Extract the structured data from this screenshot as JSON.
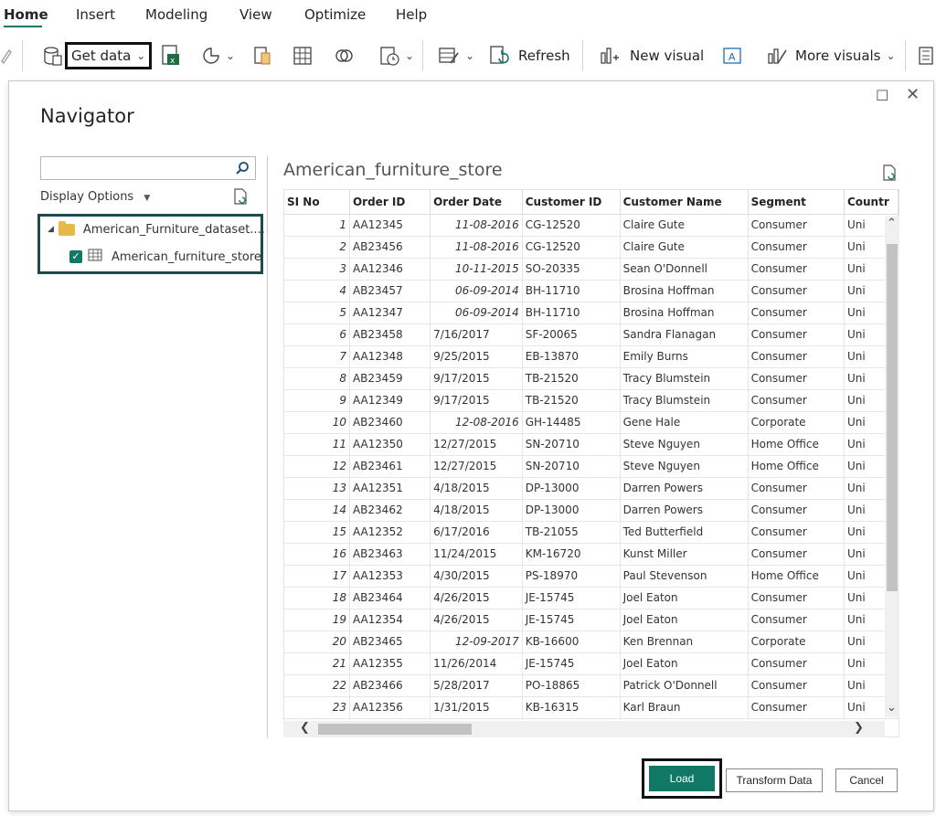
{
  "ribbon": {
    "tabs": [
      "Home",
      "Insert",
      "Modeling",
      "View",
      "Optimize",
      "Help"
    ],
    "get_data_label": "Get data",
    "refresh_label": "Refresh",
    "new_visual_label": "New visual",
    "more_visuals_label": "More visuals"
  },
  "navigator": {
    "title": "Navigator",
    "search": {
      "value": "",
      "placeholder": ""
    },
    "display_options_label": "Display Options",
    "tree": {
      "folder_label": "American_Furniture_dataset....",
      "item_label": "American_furniture_store",
      "item_checked": true
    },
    "preview_title": "American_furniture_store",
    "columns": [
      "SI No",
      "Order ID",
      "Order Date",
      "Customer ID",
      "Customer Name",
      "Segment",
      "Countr"
    ],
    "rows": [
      [
        "1",
        "AA12345",
        "11-08-2016",
        "CG-12520",
        "Claire Gute",
        "Consumer",
        "Uni"
      ],
      [
        "2",
        "AB23456",
        "11-08-2016",
        "CG-12520",
        "Claire Gute",
        "Consumer",
        "Uni"
      ],
      [
        "3",
        "AA12346",
        "10-11-2015",
        "SO-20335",
        "Sean O'Donnell",
        "Consumer",
        "Uni"
      ],
      [
        "4",
        "AB23457",
        "06-09-2014",
        "BH-11710",
        "Brosina Hoffman",
        "Consumer",
        "Uni"
      ],
      [
        "5",
        "AA12347",
        "06-09-2014",
        "BH-11710",
        "Brosina Hoffman",
        "Consumer",
        "Uni"
      ],
      [
        "6",
        "AB23458",
        "7/16/2017",
        "SF-20065",
        "Sandra Flanagan",
        "Consumer",
        "Uni"
      ],
      [
        "7",
        "AA12348",
        "9/25/2015",
        "EB-13870",
        "Emily Burns",
        "Consumer",
        "Uni"
      ],
      [
        "8",
        "AB23459",
        "9/17/2015",
        "TB-21520",
        "Tracy Blumstein",
        "Consumer",
        "Uni"
      ],
      [
        "9",
        "AA12349",
        "9/17/2015",
        "TB-21520",
        "Tracy Blumstein",
        "Consumer",
        "Uni"
      ],
      [
        "10",
        "AB23460",
        "12-08-2016",
        "GH-14485",
        "Gene Hale",
        "Corporate",
        "Uni"
      ],
      [
        "11",
        "AA12350",
        "12/27/2015",
        "SN-20710",
        "Steve Nguyen",
        "Home Office",
        "Uni"
      ],
      [
        "12",
        "AB23461",
        "12/27/2015",
        "SN-20710",
        "Steve Nguyen",
        "Home Office",
        "Uni"
      ],
      [
        "13",
        "AA12351",
        "4/18/2015",
        "DP-13000",
        "Darren Powers",
        "Consumer",
        "Uni"
      ],
      [
        "14",
        "AB23462",
        "4/18/2015",
        "DP-13000",
        "Darren Powers",
        "Consumer",
        "Uni"
      ],
      [
        "15",
        "AA12352",
        "6/17/2016",
        "TB-21055",
        "Ted Butterfield",
        "Consumer",
        "Uni"
      ],
      [
        "16",
        "AB23463",
        "11/24/2015",
        "KM-16720",
        "Kunst Miller",
        "Consumer",
        "Uni"
      ],
      [
        "17",
        "AA12353",
        "4/30/2015",
        "PS-18970",
        "Paul Stevenson",
        "Home Office",
        "Uni"
      ],
      [
        "18",
        "AB23464",
        "4/26/2015",
        "JE-15745",
        "Joel Eaton",
        "Consumer",
        "Uni"
      ],
      [
        "19",
        "AA12354",
        "4/26/2015",
        "JE-15745",
        "Joel Eaton",
        "Consumer",
        "Uni"
      ],
      [
        "20",
        "AB23465",
        "12-09-2017",
        "KB-16600",
        "Ken Brennan",
        "Corporate",
        "Uni"
      ],
      [
        "21",
        "AA12355",
        "11/26/2014",
        "JE-15745",
        "Joel Eaton",
        "Consumer",
        "Uni"
      ],
      [
        "22",
        "AB23466",
        "5/28/2017",
        "PO-18865",
        "Patrick O'Donnell",
        "Consumer",
        "Uni"
      ],
      [
        "23",
        "AA12356",
        "1/31/2015",
        "KB-16315",
        "Karl Braun",
        "Consumer",
        "Uni"
      ]
    ],
    "right_aligned_dates": [
      "11-08-2016",
      "10-11-2015",
      "06-09-2014",
      "12-08-2016",
      "12-09-2017"
    ],
    "buttons": {
      "load": "Load",
      "transform": "Transform Data",
      "cancel": "Cancel"
    }
  },
  "colors": {
    "accent": "#117865",
    "highlight_border": "#1e4a4e",
    "folder": "#e8b84a"
  }
}
